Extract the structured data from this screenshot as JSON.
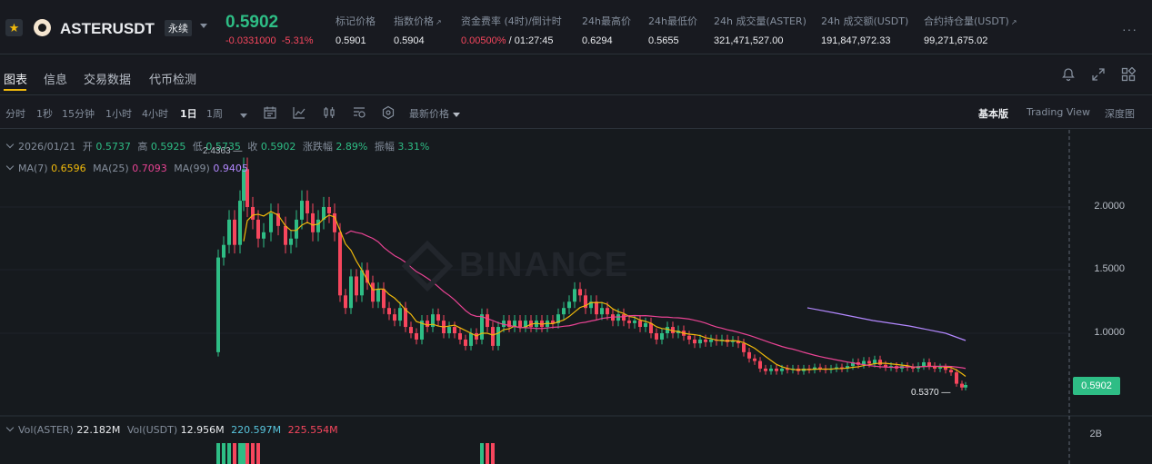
{
  "header": {
    "symbol": "ASTERUSDT",
    "contract_type": "永续",
    "last_price": "0.5902",
    "change_abs": "-0.0331000",
    "change_pct": "-5.31%",
    "stats": [
      {
        "label": "标记价格",
        "value": "0.5901"
      },
      {
        "label": "指数价格",
        "value": "0.5904"
      },
      {
        "label": "资金费率 (4时)/倒计时",
        "value_rate": "0.00500%",
        "value_countdown": " / 01:27:45"
      },
      {
        "label": "24h最高价",
        "value": "0.6294"
      },
      {
        "label": "24h最低价",
        "value": "0.5655"
      },
      {
        "label": "24h 成交量(ASTER)",
        "value": "321,471,527.00"
      },
      {
        "label": "24h 成交额(USDT)",
        "value": "191,847,972.33"
      },
      {
        "label": "合约持仓量(USDT)",
        "value": "99,271,675.02"
      }
    ],
    "more_label": "···"
  },
  "tabs": [
    "图表",
    "信息",
    "交易数据",
    "代币检测"
  ],
  "toolbar": {
    "timeframes": [
      "分时",
      "1秒",
      "15分钟",
      "1小时",
      "4小时",
      "1日",
      "1周"
    ],
    "active_timeframe": "1日",
    "price_type": "最新价格",
    "views": [
      "基本版",
      "Trading View",
      "深度图"
    ],
    "active_view": "基本版"
  },
  "legend": {
    "ohlc_date": "2026/01/21",
    "open_label": "开",
    "open": "0.5737",
    "high_label": "高",
    "high": "0.5925",
    "low_label": "低",
    "low": "0.5735",
    "close_label": "收",
    "close": "0.5902",
    "chg_label": "涨跌幅",
    "chg": "2.89%",
    "amp_label": "振幅",
    "amp": "3.31%",
    "ma7_label": "MA(7)",
    "ma7": "0.6596",
    "ma25_label": "MA(25)",
    "ma25": "0.7093",
    "ma99_label": "MA(99)",
    "ma99": "0.9405",
    "vol_aster_label": "Vol(ASTER)",
    "vol_aster": "22.182M",
    "vol_usdt_label": "Vol(USDT)",
    "vol_usdt": "12.956M",
    "vol_ma1": "220.597M",
    "vol_ma2": "225.554M"
  },
  "chart": {
    "watermark": "BINANCE",
    "y_ticks": [
      "2.0000",
      "1.5000",
      "1.0000"
    ],
    "vol_tick": "2B",
    "current_price_tag": "0.5902",
    "low_marker": "0.5370",
    "high_marker": "2.4363",
    "colors": {
      "up": "#2ebd85",
      "down": "#f6465d",
      "ma7": "#f0b90b",
      "ma25": "#e84393",
      "ma99": "#b388ff"
    }
  },
  "chart_data": {
    "type": "candlestick",
    "y_range": [
      0.45,
      2.5
    ],
    "ma7_last": 0.6596,
    "ma25_last": 0.7093,
    "ma99_last": 0.9405,
    "last_close": 0.5902,
    "marked_high": 2.4363,
    "marked_low": 0.537
  }
}
